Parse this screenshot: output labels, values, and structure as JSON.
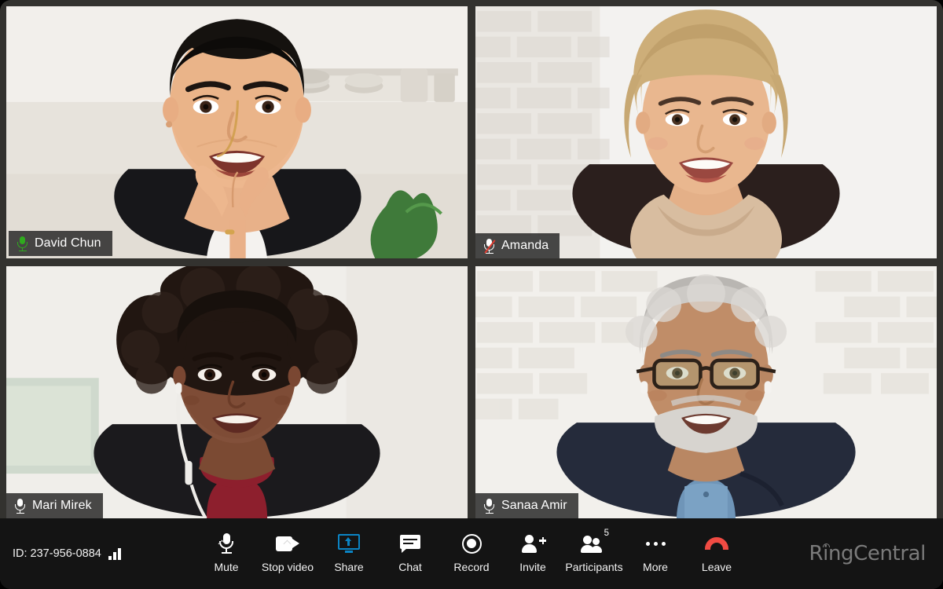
{
  "app": {
    "brand": "RingCentral",
    "brand_color": "#7b7b7b",
    "window_bg": "#33322f",
    "toolbar_bg": "#141414",
    "active_speaker_color": "#2faa1e",
    "accent_color": "#0b84c4",
    "leave_color": "#f04b43",
    "muted_slash_color": "#e03b30"
  },
  "meeting": {
    "id_label": "ID: 237-956-0884",
    "signal_icon": "signal-bars-icon",
    "signal_bars": 3
  },
  "participants": [
    {
      "name": "David Chun",
      "mic_icon": "microphone-icon",
      "mic_state": "speaking",
      "muted": false,
      "active_speaker": true,
      "position": "top-left"
    },
    {
      "name": "Amanda",
      "mic_icon": "microphone-muted-icon",
      "mic_state": "muted",
      "muted": true,
      "active_speaker": false,
      "position": "top-right"
    },
    {
      "name": "Mari Mirek",
      "mic_icon": "microphone-icon",
      "mic_state": "unmuted",
      "muted": false,
      "active_speaker": false,
      "position": "bottom-left"
    },
    {
      "name": "Sanaa Amir",
      "mic_icon": "microphone-icon",
      "mic_state": "unmuted",
      "muted": false,
      "active_speaker": false,
      "position": "bottom-right"
    }
  ],
  "toolbar": {
    "controls": [
      {
        "label": "Mute",
        "icon": "microphone-icon",
        "has_caret": true,
        "highlighted": false
      },
      {
        "label": "Stop video",
        "icon": "video-camera-icon",
        "has_caret": true,
        "highlighted": false
      },
      {
        "label": "Share",
        "icon": "share-screen-icon",
        "has_caret": false,
        "highlighted": true
      },
      {
        "label": "Chat",
        "icon": "chat-bubble-icon",
        "has_caret": false,
        "highlighted": false
      },
      {
        "label": "Record",
        "icon": "record-circle-icon",
        "has_caret": false,
        "highlighted": false
      },
      {
        "label": "Invite",
        "icon": "person-add-icon",
        "has_caret": false,
        "highlighted": false
      },
      {
        "label": "Participants",
        "icon": "people-icon",
        "has_caret": false,
        "highlighted": false,
        "badge": "5"
      },
      {
        "label": "More",
        "icon": "ellipsis-icon",
        "has_caret": false,
        "highlighted": false
      },
      {
        "label": "Leave",
        "icon": "phone-hangup-icon",
        "has_caret": false,
        "highlighted": false
      }
    ]
  }
}
